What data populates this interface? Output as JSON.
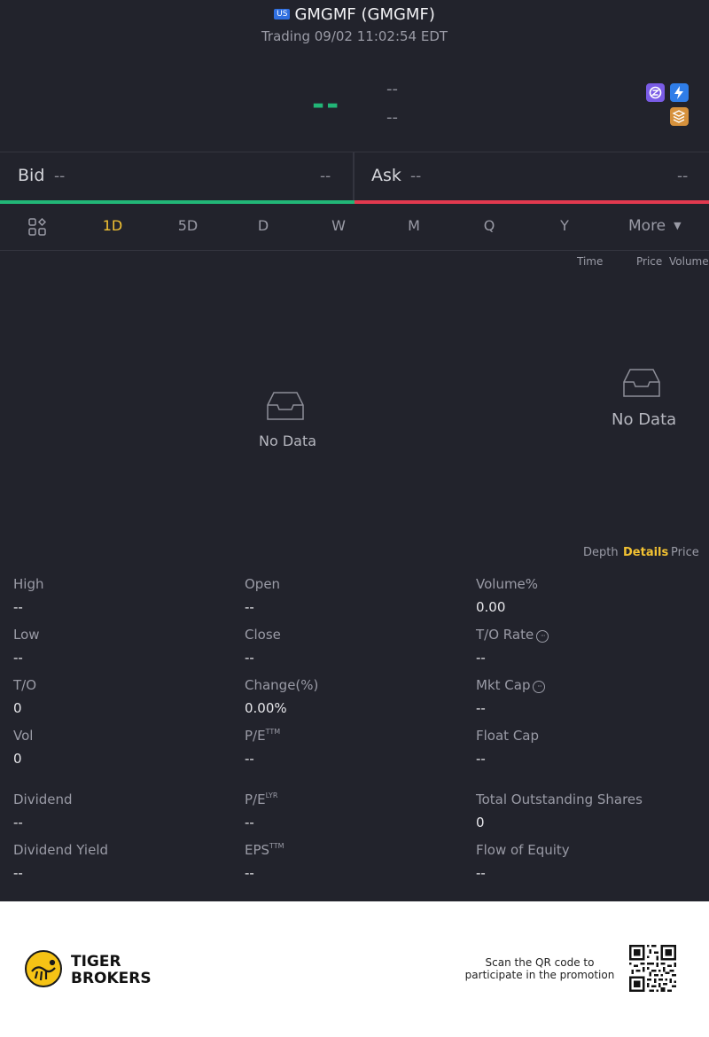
{
  "header": {
    "market_badge": "US",
    "title": "GMGMF (GMGMF)",
    "status": "Trading 09/02 11:02:54 EDT"
  },
  "quote": {
    "price": "--",
    "change": "--",
    "change_pct": "--"
  },
  "badges": [
    "zero-commission-icon",
    "lightning-icon",
    "coin-stack-icon"
  ],
  "bid_ask": {
    "bid_label": "Bid",
    "bid_price": "--",
    "bid_size": "--",
    "ask_label": "Ask",
    "ask_price": "--",
    "ask_size": "--"
  },
  "chart_tabs": {
    "items": [
      "1D",
      "5D",
      "D",
      "W",
      "M",
      "Q",
      "Y"
    ],
    "active": "1D",
    "more": "More"
  },
  "trades": {
    "columns": [
      "Time",
      "Price",
      "Volume"
    ]
  },
  "chart_empty": "No Data",
  "trades_empty": "No Data",
  "side_tabs": {
    "items": [
      "Depth",
      "Details",
      "Price"
    ],
    "active": "Details"
  },
  "stats": {
    "high": {
      "label": "High",
      "value": "--"
    },
    "open": {
      "label": "Open",
      "value": "--"
    },
    "volume_pct": {
      "label": "Volume%",
      "value": "0.00"
    },
    "low": {
      "label": "Low",
      "value": "--"
    },
    "close": {
      "label": "Close",
      "value": "--"
    },
    "to_rate": {
      "label": "T/O Rate",
      "value": "--"
    },
    "turnover": {
      "label": "T/O",
      "value": "0"
    },
    "change_pct": {
      "label": "Change(%)",
      "value": "0.00%"
    },
    "mkt_cap": {
      "label": "Mkt Cap",
      "value": "--"
    },
    "vol": {
      "label": "Vol",
      "value": "0"
    },
    "pe_ttm": {
      "label": "P/E",
      "sup": "TTM",
      "value": "--"
    },
    "float_cap": {
      "label": "Float Cap",
      "value": "--"
    },
    "dividend": {
      "label": "Dividend",
      "value": "--"
    },
    "pe_lyr": {
      "label": "P/E",
      "sup": "LYR",
      "value": "--"
    },
    "total_shares": {
      "label": "Total Outstanding Shares",
      "value": "0"
    },
    "dividend_yield": {
      "label": "Dividend Yield",
      "value": "--"
    },
    "eps_ttm": {
      "label": "EPS",
      "sup": "TTM",
      "value": "--"
    },
    "flow_equity": {
      "label": "Flow of Equity",
      "value": "--"
    }
  },
  "footer": {
    "brand_line1": "TIGER",
    "brand_line2": "BROKERS",
    "promo_line1": "Scan the QR code to",
    "promo_line2": "participate in the promotion"
  },
  "colors": {
    "background": "#22232c",
    "up": "#22b677",
    "down": "#e2394f",
    "accent": "#f3c232"
  }
}
